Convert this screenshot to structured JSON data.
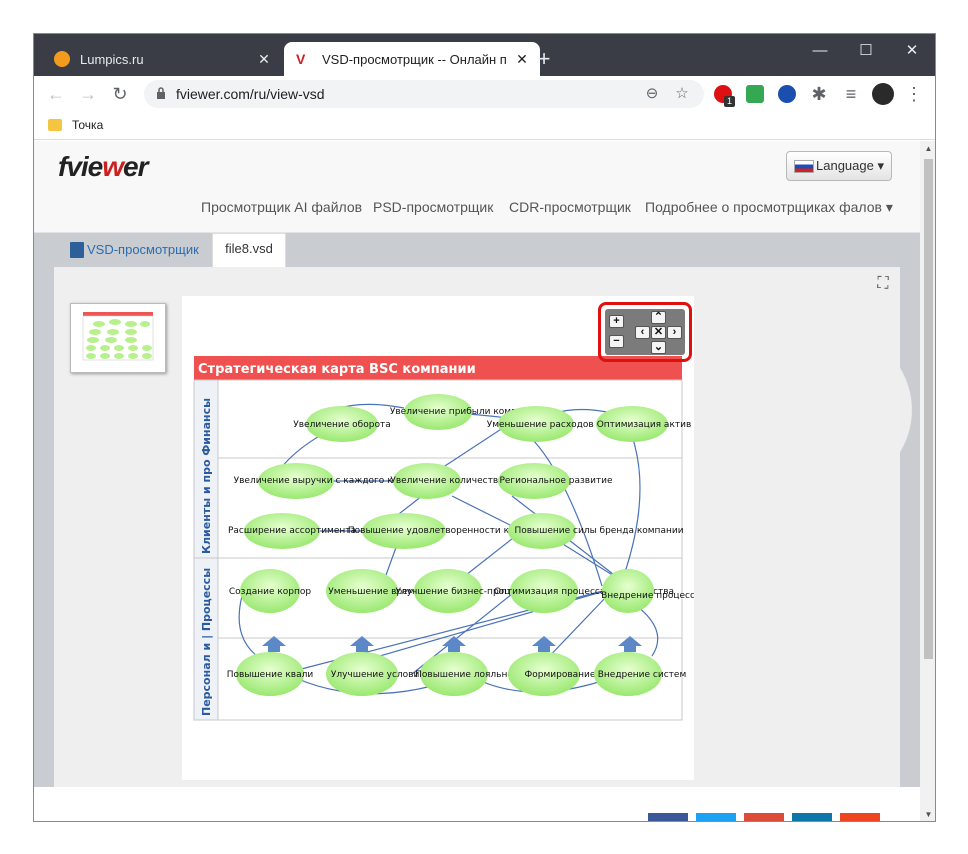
{
  "browser": {
    "tabs": [
      {
        "title": "Lumpics.ru",
        "active": false
      },
      {
        "title": "VSD-просмотрщик -- Онлайн п",
        "active": true
      }
    ],
    "url": "fviewer.com/ru/view-vsd",
    "bookmarks": [
      {
        "label": "Точка"
      }
    ],
    "extension_badge": "1",
    "colors": {
      "titlebar": "#3a3d45",
      "accent": "#cc2020"
    }
  },
  "site": {
    "logo": {
      "part1": "fvie",
      "part2": "w",
      "part3": "er"
    },
    "language_button": "Language ▾",
    "nav": [
      {
        "label": "Просмотрщик AI файлов"
      },
      {
        "label": "PSD-просмотрщик"
      },
      {
        "label": "CDR-просмотрщик"
      },
      {
        "label": "Подробнее о просмотрщиках фалов ▾"
      }
    ]
  },
  "viewer": {
    "tabs": [
      {
        "label": "VSD-просмотрщик"
      },
      {
        "label": "file8.vsd"
      }
    ],
    "zoom_controls": {
      "plus": "+",
      "minus": "−",
      "up": "⌃",
      "down": "⌄",
      "left": "‹",
      "right": "›",
      "reset": "✕"
    },
    "diagram": {
      "title": "Стратегическая карта BSC компании",
      "lanes": [
        "Клиенты и про Финансы",
        "Персонал и | Процессы"
      ],
      "nodes": [
        {
          "label": "Увеличение оборота"
        },
        {
          "label": "Увеличение прибыли компании"
        },
        {
          "label": "Уменьшение расходов компании"
        },
        {
          "label": "Оптимизация актив"
        },
        {
          "label": "Увеличение выручки с каждого клиента"
        },
        {
          "label": "Увеличение количества"
        },
        {
          "label": "Региональное развитие"
        },
        {
          "label": "Расширение ассортимента"
        },
        {
          "label": "Повышение удовлетворенности клиентов"
        },
        {
          "label": "Повышение силы бренда компании"
        },
        {
          "label": "Создание корпор"
        },
        {
          "label": "Уменьшение времени"
        },
        {
          "label": "Улучшение бизнес-процессов"
        },
        {
          "label": "Оптимизация процесса производства"
        },
        {
          "label": "Внедрение процесс"
        },
        {
          "label": "Повышение квали"
        },
        {
          "label": "Улучшение условий"
        },
        {
          "label": "Повышение лояльности"
        },
        {
          "label": "Формирование"
        },
        {
          "label": "Внедрение систем"
        }
      ]
    }
  }
}
